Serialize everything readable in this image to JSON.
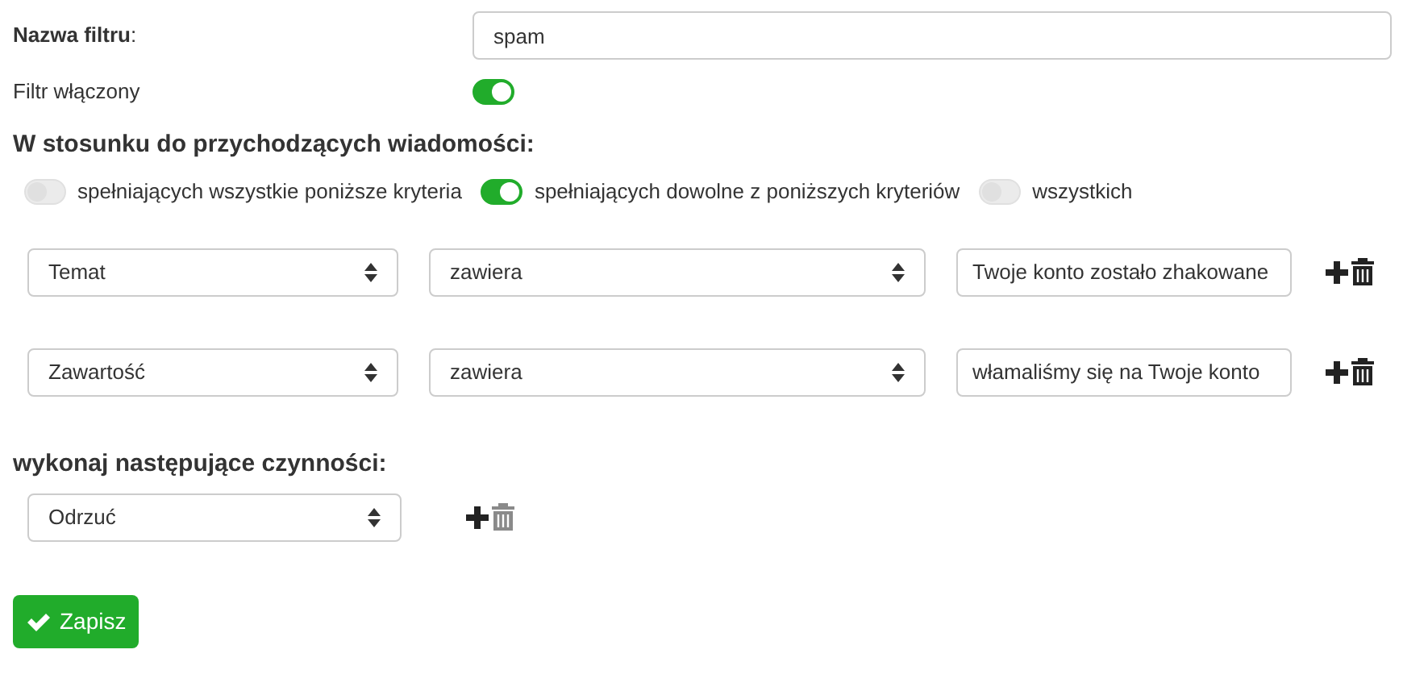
{
  "filter_name": {
    "label": "Nazwa filtru",
    "label_suffix": ":",
    "value": "spam"
  },
  "filter_enabled": {
    "label": "Filtr włączony",
    "on": true
  },
  "criteria_heading": "W stosunku do przychodzących wiadomości:",
  "match_modes": [
    {
      "label": "spełniających wszystkie poniższe kryteria",
      "selected": false
    },
    {
      "label": "spełniających dowolne z poniższych kryteriów",
      "selected": true
    },
    {
      "label": "wszystkich",
      "selected": false
    }
  ],
  "criteria": [
    {
      "field": "Temat",
      "operator": "zawiera",
      "value": "Twoje konto zostało zhakowane",
      "delete_disabled": false
    },
    {
      "field": "Zawartość",
      "operator": "zawiera",
      "value": "włamaliśmy się na Twoje konto",
      "delete_disabled": false
    }
  ],
  "actions_heading": "wykonaj następujące czynności:",
  "actions": [
    {
      "action": "Odrzuć",
      "delete_disabled": true
    }
  ],
  "save_button": "Zapisz"
}
